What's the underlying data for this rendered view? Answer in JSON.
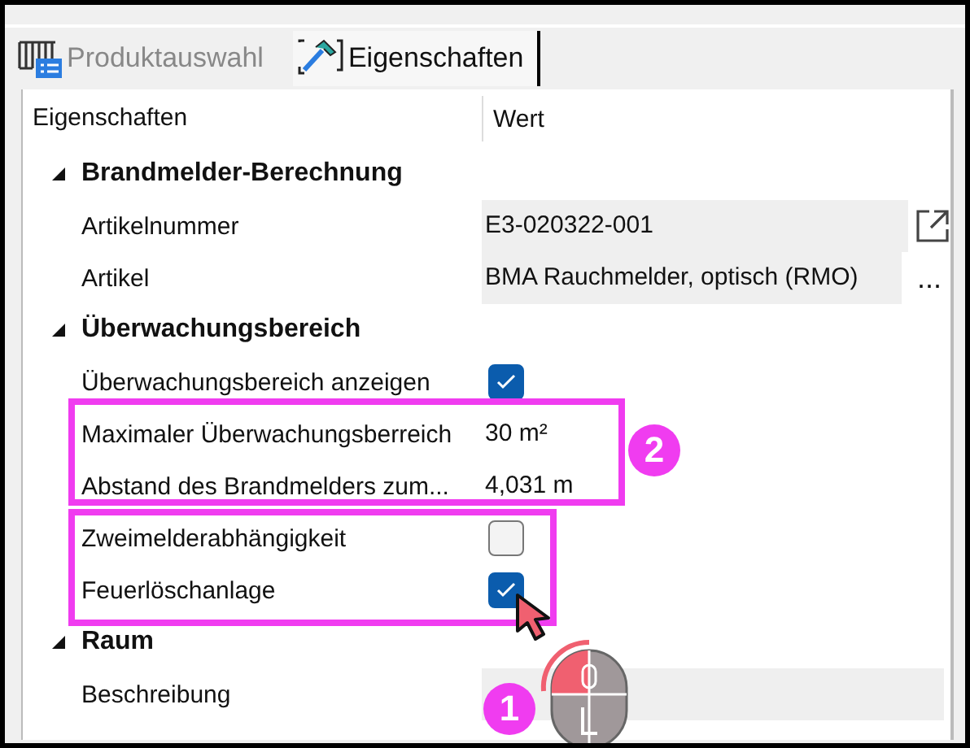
{
  "tabs": [
    {
      "label": "Produktauswahl",
      "selected": false
    },
    {
      "label": "Eigenschaften",
      "selected": true
    }
  ],
  "grid": {
    "columns": [
      "Eigenschaften",
      "Wert"
    ],
    "groups": [
      {
        "title": "Brandmelder-Berechnung",
        "expanded": true,
        "rows": [
          {
            "label": "Artikelnummer",
            "kind": "text",
            "value": "E3-020322-001",
            "shaded": true,
            "action": {
              "kind": "open"
            }
          },
          {
            "label": "Artikel",
            "kind": "text",
            "value": "BMA Rauchmelder, optisch (RMO)",
            "shaded": true,
            "action": {
              "kind": "more",
              "label": "..."
            }
          }
        ]
      },
      {
        "title": "Überwachungsbereich",
        "expanded": true,
        "rows": [
          {
            "label": "Überwachungsbereich anzeigen",
            "kind": "checkbox",
            "checked": true
          },
          {
            "label": "Maximaler Überwachungsberreich",
            "kind": "text",
            "value": "30 m²",
            "shaded": false
          },
          {
            "label": "Abstand des Brandmelders zum...",
            "kind": "text",
            "value": "4,031 m",
            "shaded": false
          },
          {
            "label": "Zweimelderabhängigkeit",
            "kind": "checkbox",
            "checked": false
          },
          {
            "label": "Feuerlöschanlage",
            "kind": "checkbox",
            "checked": true
          }
        ]
      },
      {
        "title": "Raum",
        "expanded": true,
        "rows": [
          {
            "label": "Beschreibung",
            "kind": "text",
            "shaded": true
          }
        ]
      }
    ]
  },
  "annotations": [
    {
      "kind": "frame",
      "badge": "2"
    },
    {
      "kind": "frame"
    },
    {
      "kind": "cursor"
    },
    {
      "kind": "mouse-click",
      "badge": "1"
    }
  ]
}
